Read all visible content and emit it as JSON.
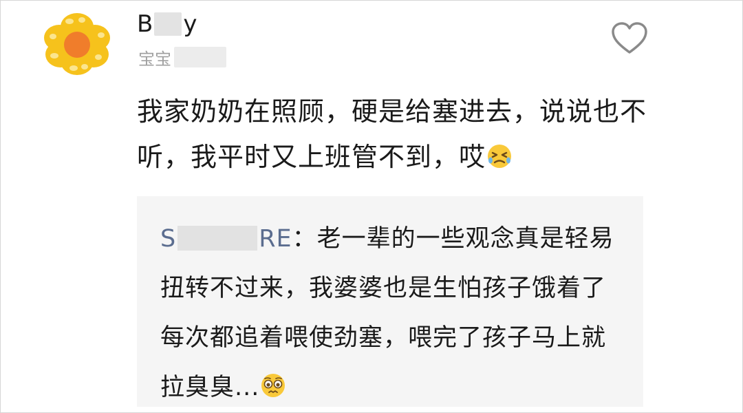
{
  "comment": {
    "username_prefix": "B",
    "username_suffix": "y",
    "subtitle_prefix": "宝宝",
    "text": "我家奶奶在照顾，硬是给塞进去，说说也不听，我平时又上班管不到，哎",
    "emoji_icon": "crying-squint-face-icon"
  },
  "reply": {
    "name_prefix": "S",
    "name_suffix": "RE",
    "separator": "：",
    "text": "老一辈的一些观念真是轻易扭转不过来，我婆婆也是生怕孩子饿着了每次都追着喂使劲塞，喂完了孩子马上就拉臭臭...",
    "emoji_icon": "pleading-face-icon"
  },
  "colors": {
    "reply_name": "#5b6d8f",
    "reply_background": "#f5f5f5",
    "subtitle": "#a0a0a0",
    "avatar_petals": "#f6c21c",
    "avatar_center": "#f07d2b"
  },
  "icons": {
    "avatar": "sunflower-avatar-icon",
    "like": "heart-outline-icon"
  }
}
